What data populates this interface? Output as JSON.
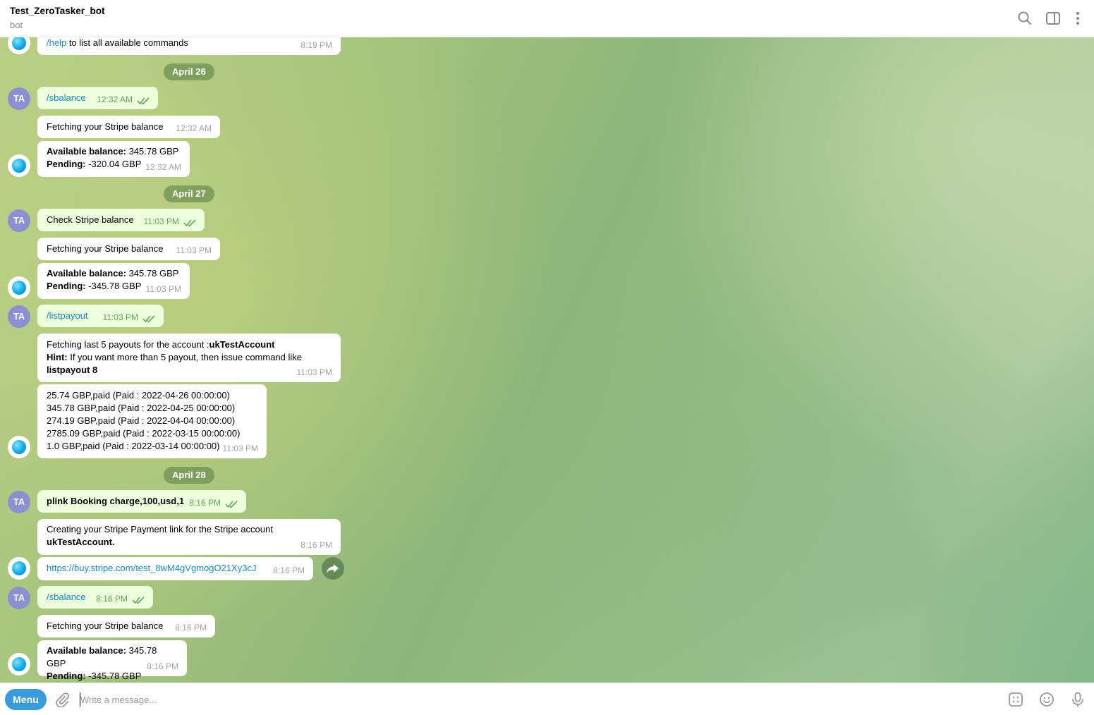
{
  "header": {
    "title": "Test_ZeroTasker_bot",
    "subtitle": "bot"
  },
  "messages": {
    "m0": {
      "cmd": "/help",
      "text": " to list all available commands",
      "time": "8:19 PM"
    },
    "d1": "April 26",
    "m1": {
      "avatar": "TA",
      "text": "/sbalance",
      "time": "12:32 AM"
    },
    "m2": {
      "text": "Fetching your Stripe balance",
      "time": "12:32 AM"
    },
    "m3": {
      "l1_label": "Available balance:",
      "l1_value": "  345.78 GBP",
      "l2_label": "Pending:",
      "l2_value": " -320.04 GBP",
      "time": "12:32 AM"
    },
    "d2": "April 27",
    "m4": {
      "avatar": "TA",
      "text": "Check Stripe balance",
      "time": "11:03 PM"
    },
    "m5": {
      "text": "Fetching your Stripe balance",
      "time": "11:03 PM"
    },
    "m6": {
      "l1_label": "Available balance:",
      "l1_value": "  345.78 GBP",
      "l2_label": "Pending:",
      "l2_value": " -345.78 GBP",
      "time": "11:03 PM"
    },
    "m7": {
      "avatar": "TA",
      "text": "/listpayout",
      "time": "11:03 PM"
    },
    "m8": {
      "l1_text": "Fetching last 5 payouts for the account :",
      "l1_bold": "ukTestAccount",
      "l2_label": "Hint:",
      "l2_text": " If you want more than 5 payout, then issue command like",
      "l3_bold": "listpayout 8",
      "time": "11:03 PM"
    },
    "m9": {
      "lines": [
        "25.74 GBP,paid (Paid : 2022-04-26 00:00:00)",
        "345.78 GBP,paid (Paid : 2022-04-25 00:00:00)",
        "274.19 GBP,paid (Paid : 2022-04-04 00:00:00)",
        "2785.09 GBP,paid (Paid : 2022-03-15 00:00:00)",
        "1.0 GBP,paid (Paid : 2022-03-14 00:00:00)"
      ],
      "time": "11:03 PM"
    },
    "d3": "April 28",
    "m10": {
      "avatar": "TA",
      "text": "plink Booking charge,100,usd,1",
      "time": "8:16 PM"
    },
    "m11": {
      "l1": "Creating your Stripe Payment link for the Stripe account",
      "l2": "ukTestAccount.",
      "time": "8:16 PM"
    },
    "m12": {
      "link": "https://buy.stripe.com/test_8wM4gVgmogO21Xy3cJ",
      "time": "8:16 PM"
    },
    "m13": {
      "avatar": "TA",
      "text": "/sbalance",
      "time": "8:16 PM"
    },
    "m14": {
      "text": "Fetching your Stripe balance",
      "time": "8:16 PM"
    },
    "m15": {
      "l1_label": "Available balance:",
      "l1_value": "  345.78 GBP",
      "l2_label": "Pending:",
      "l2_value": " -345.78 GBP",
      "time": "8:16 PM"
    }
  },
  "composer": {
    "menu_label": "Menu",
    "placeholder": "Write a message..."
  },
  "icons": {
    "header": [
      "search-icon",
      "sidebar-toggle-icon",
      "more-vertical-icon"
    ],
    "composer": [
      "attach-icon",
      "bot-commands-icon",
      "emoji-icon",
      "microphone-icon"
    ],
    "chat": [
      "forward-icon"
    ]
  },
  "colors": {
    "accent": "#3a9bdc",
    "outgoing_bubble": "#eeffde",
    "link": "#168acd",
    "avatar": "#8c8fd1"
  }
}
